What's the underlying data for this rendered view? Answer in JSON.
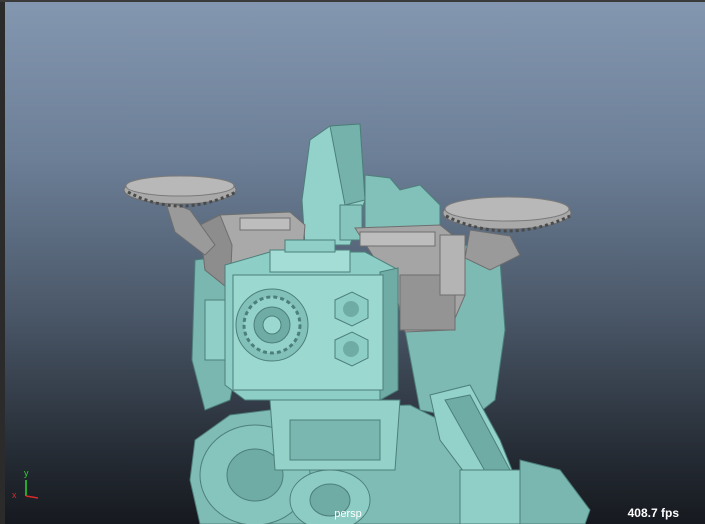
{
  "viewport": {
    "camera_label": "persp",
    "fps_label": "408.7 fps"
  },
  "axis_gizmo": {
    "x_label": "x",
    "y_label": "y"
  },
  "colors": {
    "model_teal": "#8fd0c8",
    "model_teal_shadow": "#5f9e98",
    "model_grey": "#a9a9a9",
    "model_grey_shadow": "#7e7e7e",
    "axis_x": "#d62a2a",
    "axis_y": "#2ad62a"
  }
}
